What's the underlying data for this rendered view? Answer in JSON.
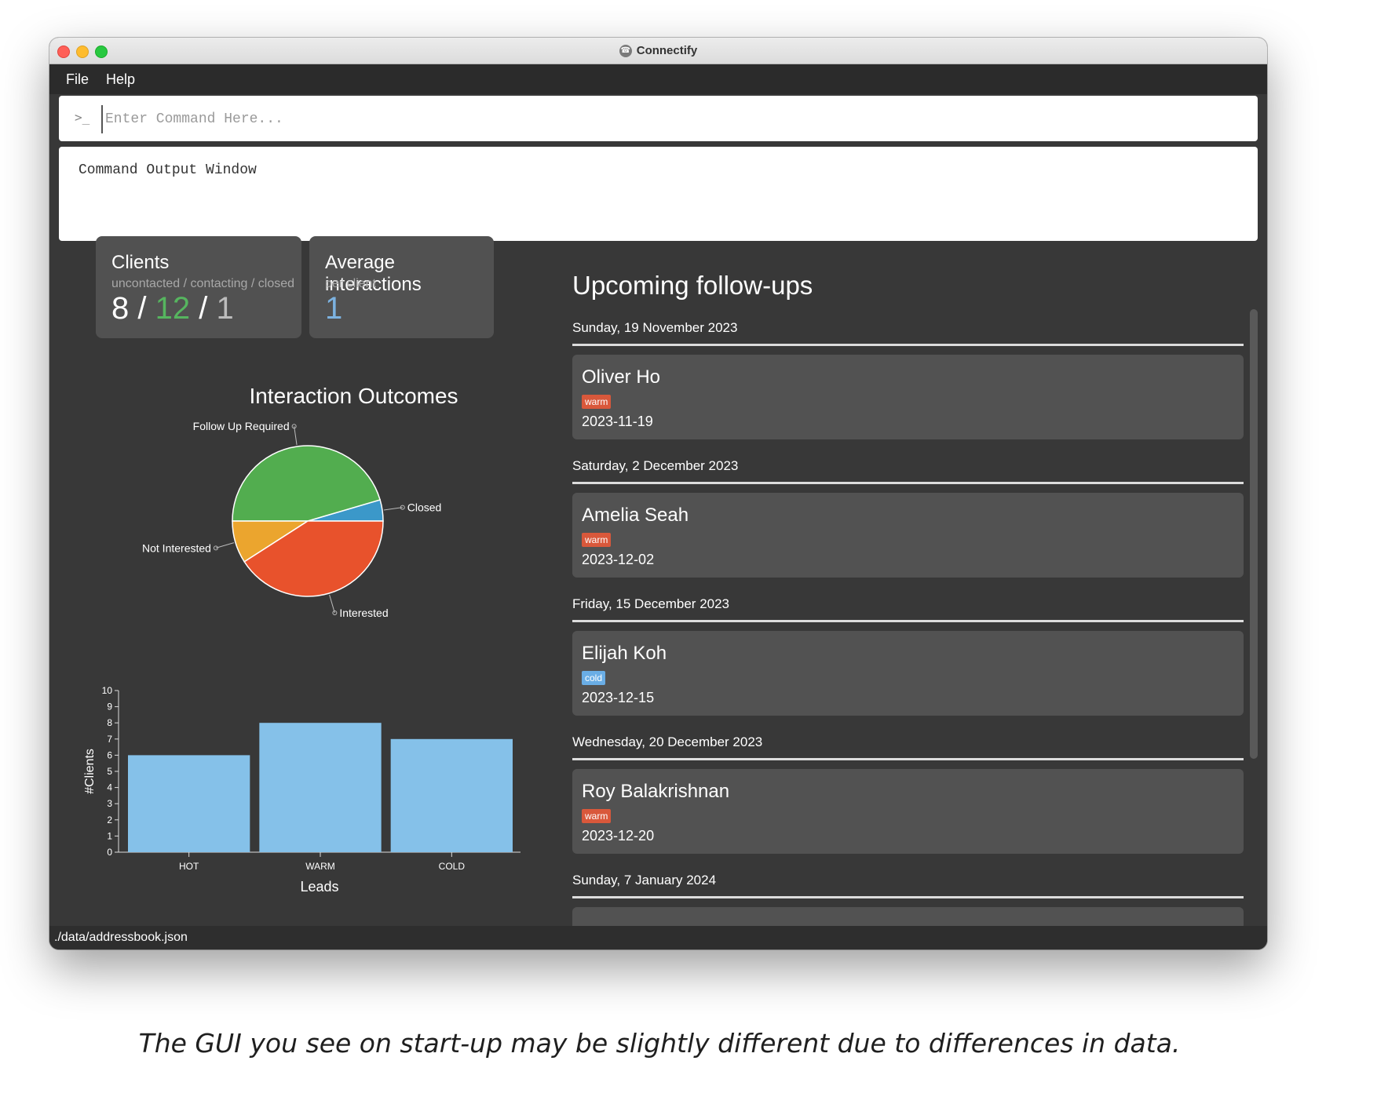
{
  "window": {
    "title": "Connectify"
  },
  "menu": {
    "items": [
      "File",
      "Help"
    ]
  },
  "command": {
    "placeholder": "Enter Command Here...",
    "prompt_icon": "terminal-prompt-icon"
  },
  "output": {
    "text": "Command Output Window"
  },
  "clients_card": {
    "title": "Clients",
    "subtitle": "uncontacted / contacting / closed",
    "uncontacted": "8",
    "contacting": "12",
    "closed": "1",
    "separator": "/"
  },
  "avg_card": {
    "title": "Average interactions",
    "subtitle": "per client",
    "value": "1"
  },
  "colors": {
    "green": "#56b55f",
    "blue": "#7cb2e0",
    "warm_tag": "#d9583b",
    "cold_tag": "#6aaee6",
    "bar": "#85c1e9"
  },
  "chart_data": [
    {
      "type": "pie",
      "title": "Interaction Outcomes",
      "labels": [
        "Closed",
        "Follow Up Required",
        "Not Interested",
        "Interested"
      ],
      "values": [
        1,
        10,
        2,
        9
      ],
      "colors": [
        "#3b98c9",
        "#52ad4f",
        "#eba52e",
        "#e8522c"
      ]
    },
    {
      "type": "bar",
      "categories": [
        "HOT",
        "WARM",
        "COLD"
      ],
      "values": [
        6,
        8,
        7
      ],
      "xlabel": "Leads",
      "ylabel": "#Clients",
      "ylim": [
        0,
        10
      ],
      "yticks": [
        0,
        1,
        2,
        3,
        4,
        5,
        6,
        7,
        8,
        9,
        10
      ],
      "grid": false
    }
  ],
  "upcoming": {
    "title": "Upcoming follow-ups",
    "groups": [
      {
        "date_label": "Sunday, 19 November 2023",
        "name": "Oliver Ho",
        "tag": "warm",
        "date": "2023-11-19"
      },
      {
        "date_label": "Saturday, 2 December 2023",
        "name": "Amelia Seah",
        "tag": "warm",
        "date": "2023-12-02"
      },
      {
        "date_label": "Friday, 15 December 2023",
        "name": "Elijah Koh",
        "tag": "cold",
        "date": "2023-12-15"
      },
      {
        "date_label": "Wednesday, 20 December 2023",
        "name": "Roy Balakrishnan",
        "tag": "warm",
        "date": "2023-12-20"
      },
      {
        "date_label": "Sunday, 7 January 2024",
        "name": "",
        "tag": "",
        "date": ""
      }
    ]
  },
  "status": {
    "path": "./data/addressbook.json"
  },
  "caption": {
    "text": "The GUI you see on start-up may be slightly different due to differences in data."
  }
}
